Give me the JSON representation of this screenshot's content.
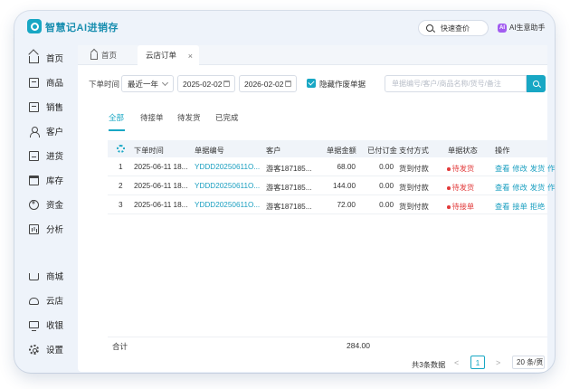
{
  "app": {
    "brand": "智慧记AI进销存",
    "quick_price": "快速查价",
    "ai_badge": "AI",
    "ai_helper": "AI生意助手"
  },
  "sidebar": {
    "items": [
      {
        "label": "首页",
        "icon": "home-icon"
      },
      {
        "label": "商品",
        "icon": "box-icon"
      },
      {
        "label": "销售",
        "icon": "sales-icon"
      },
      {
        "label": "客户",
        "icon": "person-icon"
      },
      {
        "label": "进货",
        "icon": "truck-icon"
      },
      {
        "label": "库存",
        "icon": "warehouse-icon"
      },
      {
        "label": "资金",
        "icon": "yen-icon"
      },
      {
        "label": "分析",
        "icon": "chart-icon"
      },
      {
        "label": "商城",
        "icon": "cart-icon"
      },
      {
        "label": "云店",
        "icon": "cloud-store-icon"
      },
      {
        "label": "收银",
        "icon": "monitor-icon"
      },
      {
        "label": "设置",
        "icon": "gear-icon"
      }
    ]
  },
  "tabs": {
    "home": "首页",
    "active": "云店订单",
    "close": "×"
  },
  "filters": {
    "label": "下单时间",
    "range": "最近一年",
    "start_date": "2025-02-02",
    "end_date": "2026-02-02",
    "hide_void_label": "隐藏作废单据",
    "hide_void_checked": true,
    "search_placeholder": "单据编号/客户/商品名称/货号/备注"
  },
  "status_tabs": [
    "全部",
    "待接单",
    "待发货",
    "已完成"
  ],
  "table": {
    "headers": [
      "下单时间",
      "单据编号",
      "客户",
      "单据金额",
      "已付订金",
      "支付方式",
      "单据状态",
      "操作"
    ],
    "rows": [
      {
        "index": "1",
        "time": "2025-06-11 18...",
        "number": "YDDD20250611O...",
        "customer": "游客187185...",
        "amount": "68.00",
        "deposit": "0.00",
        "payment": "货到付款",
        "status": "待发货",
        "ops": [
          "查看",
          "修改",
          "发货",
          "作废"
        ]
      },
      {
        "index": "2",
        "time": "2025-06-11 18...",
        "number": "YDDD20250611O...",
        "customer": "游客187185...",
        "amount": "144.00",
        "deposit": "0.00",
        "payment": "货到付款",
        "status": "待发货",
        "ops": [
          "查看",
          "修改",
          "发货",
          "作废"
        ]
      },
      {
        "index": "3",
        "time": "2025-06-11 18...",
        "number": "YDDD20250611O...",
        "customer": "游客187185...",
        "amount": "72.00",
        "deposit": "0.00",
        "payment": "货到付款",
        "status": "待接单",
        "ops": [
          "查看",
          "接单",
          "拒绝"
        ]
      }
    ],
    "total_label": "合计",
    "total_amount": "284.00"
  },
  "pager": {
    "total": "共3条数据",
    "prev": "<",
    "current": "1",
    "next": ">",
    "page_size": "20 条/页"
  },
  "colors": {
    "accent": "#18a7c4",
    "status_red": "#e23b3b",
    "ai_purple": "#a25cf0"
  }
}
